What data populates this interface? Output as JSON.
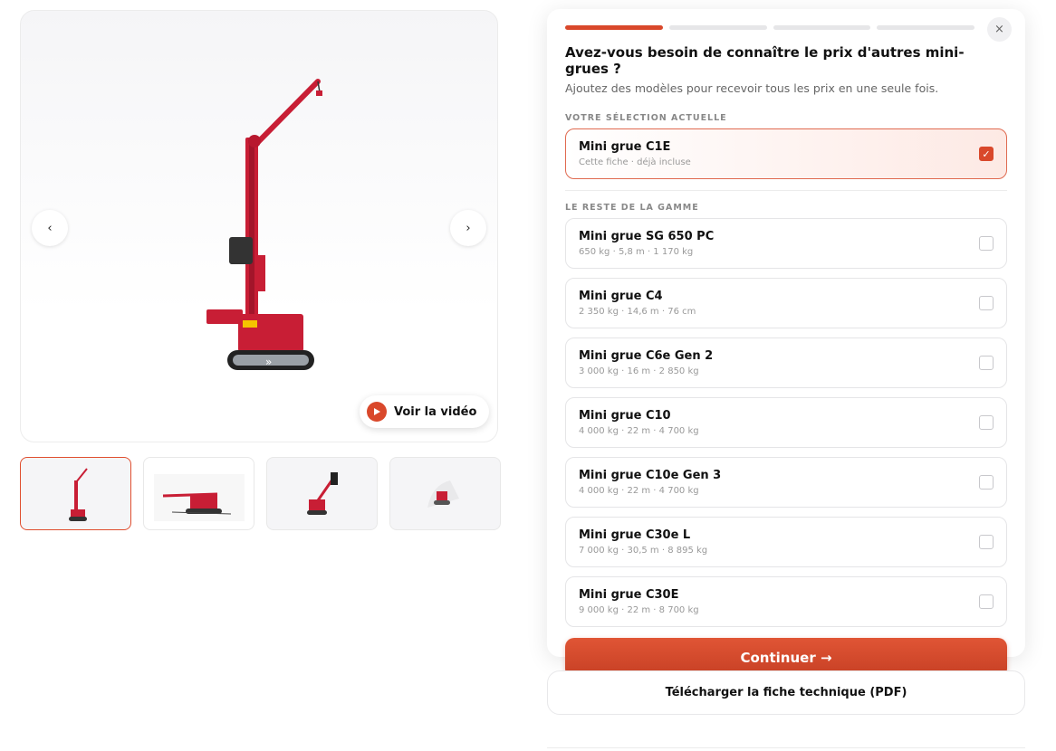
{
  "gallery": {
    "prev_label": "‹",
    "next_label": "›",
    "video_label": "Voir la vidéo",
    "thumbnail_count": 4,
    "active_thumbnail": 1
  },
  "modal": {
    "progress_steps": 4,
    "progress_done": 1,
    "close_label": "×",
    "title": "Avez-vous besoin de connaître le prix d'autres mini-grues ?",
    "subtitle": "Ajoutez des modèles pour recevoir tous les prix en une seule fois.",
    "current_label": "VOTRE SÉLECTION ACTUELLE",
    "current_item": {
      "name": "Mini grue C1E",
      "spec": "Cette fiche · déjà incluse",
      "checked": true
    },
    "rest_label": "LE RESTE DE LA GAMME",
    "items": [
      {
        "name": "Mini grue SG 650 PC",
        "spec": "650 kg · 5,8 m · 1 170 kg",
        "checked": false
      },
      {
        "name": "Mini grue C4",
        "spec": "2 350 kg · 14,6 m · 76 cm",
        "checked": false
      },
      {
        "name": "Mini grue C6e Gen 2",
        "spec": "3 000 kg · 16 m · 2 850 kg",
        "checked": false
      },
      {
        "name": "Mini grue C10",
        "spec": "4 000 kg · 22 m · 4 700 kg",
        "checked": false
      },
      {
        "name": "Mini grue C10e Gen 3",
        "spec": "4 000 kg · 22 m · 4 700 kg",
        "checked": false
      },
      {
        "name": "Mini grue C30e L",
        "spec": "7 000 kg · 30,5 m · 8 895 kg",
        "checked": false
      },
      {
        "name": "Mini grue C30E",
        "spec": "9 000 kg · 22 m · 8 700 kg",
        "checked": false
      }
    ],
    "continue_label": "Continuer →"
  },
  "download_label": "Télécharger la fiche technique (PDF)",
  "colors": {
    "accent": "#d9482b",
    "crane_red": "#c81e35"
  }
}
